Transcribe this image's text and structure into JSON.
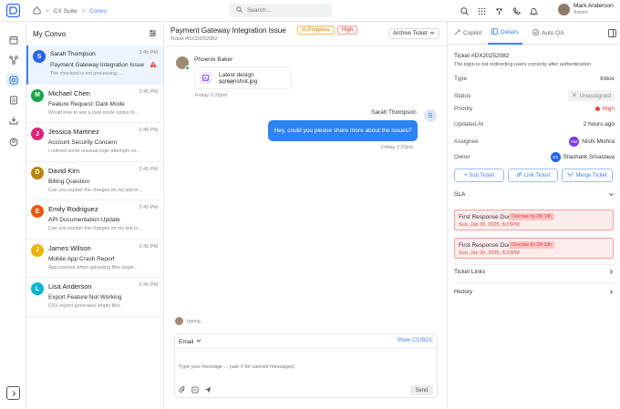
{
  "app": {
    "breadcrumb": [
      "CX Suite",
      "Convo"
    ],
    "search_placeholder": "Search...",
    "user_name": "Mark Anderson",
    "user_role": "Admin"
  },
  "list": {
    "title": "My Convo",
    "conversations": [
      {
        "initial": "S",
        "name": "Sarah Thompson",
        "time": "3:45 PM",
        "subject": "Payment Gateway Integration Issue",
        "preview": "The checkout is not processing......",
        "color": "#2563eb"
      },
      {
        "initial": "M",
        "name": "Michael Chen",
        "time": "2:45 PM",
        "subject": "Feature Request: Dark Mode",
        "preview": "Would love to see a dark mode option fo...",
        "color": "#16a34a"
      },
      {
        "initial": "J",
        "name": "Jessica Martinez",
        "time": "2:45 PM",
        "subject": "Account Security Concern",
        "preview": "I noticed some unusual login attempts on...",
        "color": "#db2777"
      },
      {
        "initial": "D",
        "name": "David Kim",
        "time": "2:45 PM",
        "subject": "Billing Question",
        "preview": "Can you explain the charges on my last in...",
        "color": "#b8860b"
      },
      {
        "initial": "E",
        "name": "Emily Rodriguez",
        "time": "2:45 PM",
        "subject": "API Documentation Update",
        "preview": "Can you explain the charges on my last in...",
        "color": "#ea580c"
      },
      {
        "initial": "J",
        "name": "James Wilson",
        "time": "2:45 PM",
        "subject": "Mobile App Crash Report",
        "preview": "App crashes when uploading files larger...",
        "color": "#eab308"
      },
      {
        "initial": "L",
        "name": "Lisa Anderson",
        "time": "2:45 PM",
        "subject": "Export Feature Not Working",
        "preview": "CSV export generates empty files",
        "color": "#06b6d4"
      }
    ]
  },
  "ticket": {
    "title": "Payment Gateway Integration Issue",
    "id": "Ticket #DX20252082",
    "status": "In Progress",
    "priority": "High",
    "archive_label": "Archive Ticket"
  },
  "messages": {
    "incoming_sender": "Phoenix Baker",
    "file_name": "Latest design screenshot.jpg",
    "file_size": "1.2 MB",
    "incoming_time": "Friday 2:20pm",
    "outgoing_sender": "Sarah Thompson",
    "outgoing_initial": "S",
    "outgoing_text": "Hey, could you please share more about the issues?",
    "outgoing_time": "Friday 2:20pm",
    "typing": "typing..."
  },
  "composer": {
    "channel": "Email",
    "cc_label": "Show CC/BCC",
    "placeholder": "Type your message ... (use # for canned messages)",
    "send_label": "Send"
  },
  "panel": {
    "tabs": [
      "Copilot",
      "Details",
      "Auto QA"
    ],
    "ticket_id": "Ticket #DX20252082",
    "ticket_desc": "The login is not redirecting users correctly after authentication",
    "type_label": "Type",
    "type_value": "Inbox",
    "status_label": "Status",
    "status_value": "Unassigned",
    "priority_label": "Priority",
    "priority_value": "High",
    "updated_label": "Updated At",
    "updated_value": "2 hours ago",
    "assignee_label": "Assignee",
    "assignee_initials": "NM",
    "assignee_value": "Nishi Mishra",
    "owner_label": "Owner",
    "owner_initials": "SS",
    "owner_value": "Shashank Srivastava",
    "actions": [
      "Sub Ticket",
      "Link Ticket",
      "Merge Ticket"
    ],
    "sla_label": "SLA",
    "sla_items": [
      {
        "title": "First Response Due",
        "overdue": "Overdue by 2M 18h",
        "date": "Sun, Jan 26, 2025, 8:23PM"
      },
      {
        "title": "First Response Due",
        "overdue": "Overdue by 2M 18h",
        "date": "Sun, Jan 26, 2025, 8:23PM"
      }
    ],
    "ticket_links": "Ticket Links",
    "history": "History"
  },
  "colors": {
    "accent": "#3b82f6",
    "danger": "#e0443b",
    "bubble": "#2d83f2"
  }
}
